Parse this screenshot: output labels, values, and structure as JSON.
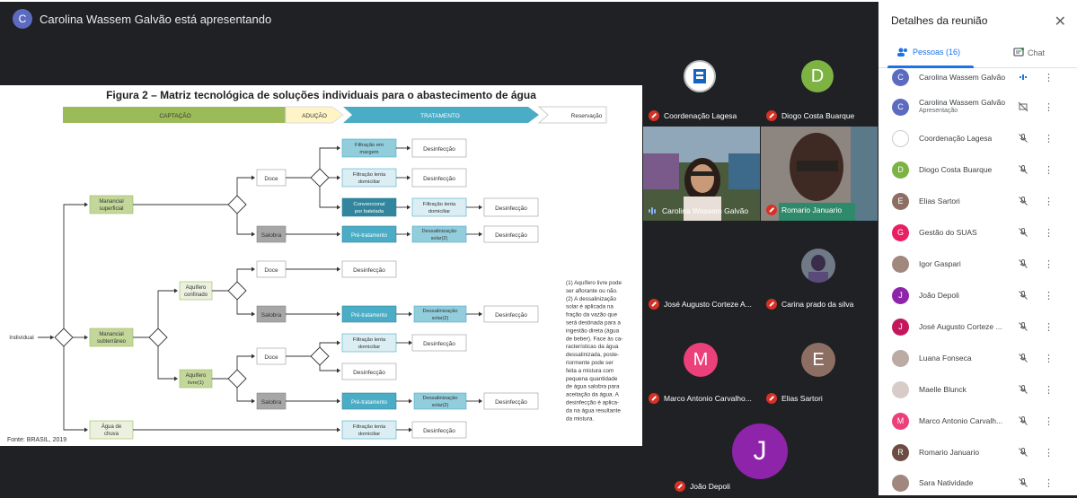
{
  "presenter": {
    "initial": "C",
    "text": "Carolina Wassem Galvão está apresentando"
  },
  "slide": {
    "title": "Figura 2 – Matriz tecnológica de soluções individuais para o abastecimento de água",
    "stages": [
      "CAPTAÇÃO",
      "ADUÇÃO",
      "TRATAMENTO",
      "Reservação"
    ],
    "source": "Fonte: BRASIL, 2019",
    "note_lines": [
      "(1) Aquífero livre pode",
      "ser aflorante ou não.",
      "(2) A dessalinização",
      "solar é aplicada na",
      "fração da vazão que",
      "será destinada para a",
      "ingestão direta (água",
      "de beber). Face às ca-",
      "racterísticas da água",
      "dessalinizada, poste-",
      "riormente pode ser",
      "feita a mistura com",
      "pequena quantidade",
      "de água salobra para",
      "aceitação da água. A",
      "desinfecção é aplica-",
      "da na água resultante",
      "da mistura."
    ],
    "labels": {
      "individual": "Individual",
      "superficial": [
        "Manancial",
        "superficial"
      ],
      "subterraneo": [
        "Manancial",
        "subterrâneo"
      ],
      "chuva": [
        "Água de",
        "chuva"
      ],
      "confinado": [
        "Aquífero",
        "confinado"
      ],
      "livre": [
        "Aquífero",
        "livre(1)"
      ],
      "doce": "Doce",
      "salobra": "Salobra",
      "desinfeccao": "Desinfecção",
      "filtracao_margem": [
        "Filtração em",
        "margem"
      ],
      "filtracao_lenta": [
        "Filtração lenta",
        "domiciliar"
      ],
      "convencional": [
        "Convencional",
        "por batelada"
      ],
      "pretratamento": "Pré-tratamento",
      "dessalinizacao": [
        "Dessalinização",
        "solar(2)"
      ]
    }
  },
  "tiles": [
    {
      "name": "Coordenação Lagesa"
    },
    {
      "name": "Diogo Costa Buarque",
      "initial": "D"
    },
    {
      "name": "Carolina Wassem Galvão"
    },
    {
      "name": "Romario Januario"
    },
    {
      "name": "José Augusto Corteze A..."
    },
    {
      "name": "Carina prado da silva"
    },
    {
      "name": "Marco Antonio Carvalho...",
      "initial": "M"
    },
    {
      "name": "Elias Sartori",
      "initial": "E"
    },
    {
      "name": "João Depoli",
      "initial": "J"
    }
  ],
  "panel": {
    "title": "Detalhes da reunião",
    "people_tab": "Pessoas (16)",
    "chat_tab": "Chat",
    "participants": [
      {
        "name": "Carolina Wassem Galvão",
        "initial": "C",
        "color": "#5c6bc0"
      },
      {
        "name": "Carolina Wassem Galvão",
        "sub": "Apresentação",
        "initial": "C",
        "color": "#5c6bc0"
      },
      {
        "name": "Coordenação Lagesa",
        "initial": "",
        "color": "#ffffff"
      },
      {
        "name": "Diogo Costa Buarque",
        "initial": "D",
        "color": "#7cb342"
      },
      {
        "name": "Elias Sartori",
        "initial": "E",
        "color": "#8d6e63"
      },
      {
        "name": "Gestão do SUAS",
        "initial": "G",
        "color": "#e91e63"
      },
      {
        "name": "Igor Gaspari",
        "initial": "",
        "color": "#a1887f"
      },
      {
        "name": "João Depoli",
        "initial": "J",
        "color": "#8e24aa"
      },
      {
        "name": "José Augusto Corteze ...",
        "initial": "J",
        "color": "#c2185b"
      },
      {
        "name": "Luana Fonseca",
        "initial": "",
        "color": "#bcaaa4"
      },
      {
        "name": "Maelle Blunck",
        "initial": "",
        "color": "#d7ccc8"
      },
      {
        "name": "Marco Antonio Carvalh...",
        "initial": "M",
        "color": "#ec407a"
      },
      {
        "name": "Romario Januario",
        "initial": "R",
        "color": "#6d4c41"
      },
      {
        "name": "Sara Natividade",
        "initial": "",
        "color": "#a1887f"
      }
    ]
  }
}
